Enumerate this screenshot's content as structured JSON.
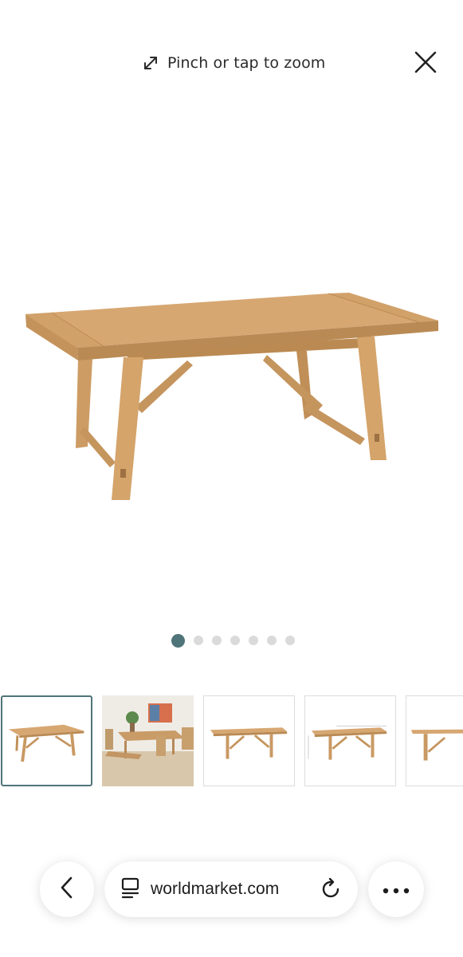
{
  "zoom_hint": {
    "text": "Pinch or tap to zoom",
    "icon": "expand-arrows-icon"
  },
  "close": {
    "icon": "close-icon"
  },
  "main_image": {
    "alt": "wood trestle dining table"
  },
  "carousel": {
    "total": 7,
    "active_index": 0,
    "active_color": "#4f7479",
    "inactive_color": "#dadada"
  },
  "thumbnails": [
    {
      "label": "table front view",
      "active": true
    },
    {
      "label": "dining room scene",
      "active": false
    },
    {
      "label": "table side view",
      "active": false
    },
    {
      "label": "table with dimensions",
      "active": false
    },
    {
      "label": "table end view",
      "active": false
    }
  ],
  "browser": {
    "url": "worldmarket.com",
    "back_icon": "chevron-left-icon",
    "site_icon": "tabs-icon",
    "reload_icon": "reload-icon",
    "more_icon": "more-dots-icon"
  },
  "colors": {
    "accent": "#4f7479",
    "wood": "#d7a772"
  }
}
